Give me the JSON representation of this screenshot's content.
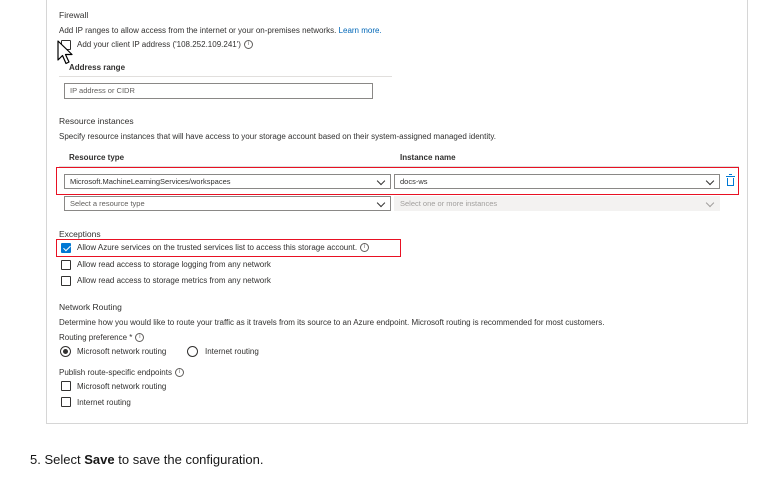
{
  "firewall": {
    "title": "Firewall",
    "description": "Add IP ranges to allow access from the internet or your on-premises networks.",
    "learn_more": "Learn more.",
    "add_client_ip": "Add your client IP address ('108.252.109.241')",
    "address_range_label": "Address range",
    "address_range_placeholder": "IP address or CIDR"
  },
  "resource_instances": {
    "title": "Resource instances",
    "description": "Specify resource instances that will have access to your storage account based on their system-assigned managed identity.",
    "col_resource_type": "Resource type",
    "col_instance_name": "Instance name",
    "rows": [
      {
        "resource_type": "Microsoft.MachineLearningServices/workspaces",
        "instance": "docs-ws"
      }
    ],
    "new_resource_placeholder": "Select a resource type",
    "new_instance_placeholder": "Select one or more instances"
  },
  "exceptions": {
    "title": "Exceptions",
    "items": [
      {
        "label": "Allow Azure services on the trusted services list to access this storage account.",
        "checked": true
      },
      {
        "label": "Allow read access to storage logging from any network",
        "checked": false
      },
      {
        "label": "Allow read access to storage metrics from any network",
        "checked": false
      }
    ]
  },
  "network_routing": {
    "title": "Network Routing",
    "description": "Determine how you would like to route your traffic as it travels from its source to an Azure endpoint. Microsoft routing is recommended for most customers.",
    "routing_pref_label": "Routing preference *",
    "options": [
      "Microsoft network routing",
      "Internet routing"
    ],
    "selected": "Microsoft network routing",
    "publish_label": "Publish route-specific endpoints",
    "publish_items": [
      "Microsoft network routing",
      "Internet routing"
    ]
  },
  "step": {
    "number": "5.",
    "pre": "Select",
    "bold": "Save",
    "post": "to save the configuration."
  },
  "colors": {
    "accent": "#0078d4",
    "highlight": "#e81123",
    "link": "#0067b8"
  }
}
